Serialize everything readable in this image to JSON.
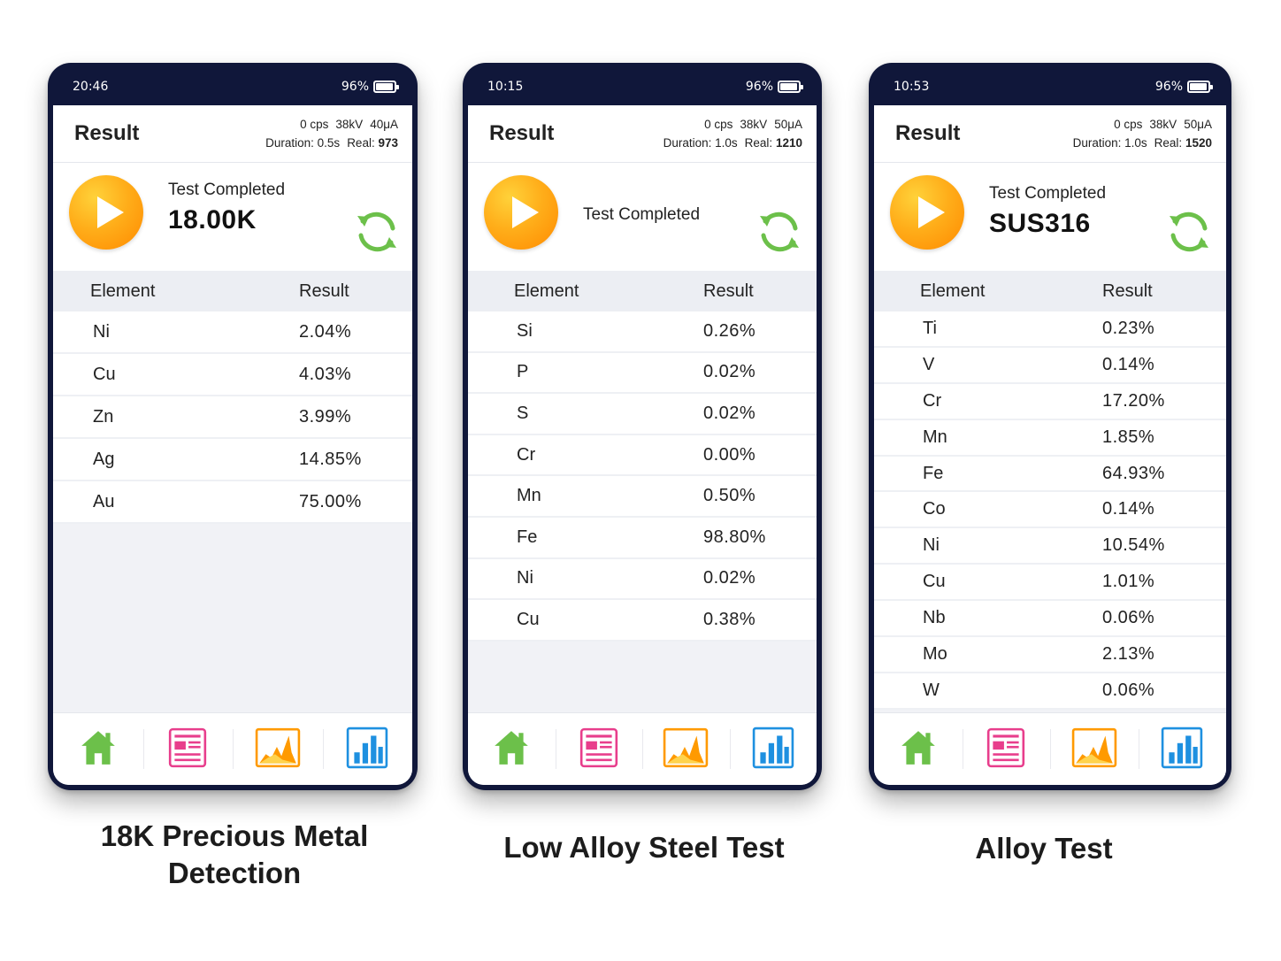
{
  "colors": {
    "frame": "#10173a",
    "play": "#ff9a00",
    "refresh": "#6cc04a",
    "home": "#6cc04a",
    "report": "#e83e8c",
    "spectrum": "#ff9a00",
    "bar_chart": "#1e90e0"
  },
  "icons": [
    "play-icon",
    "refresh-icon",
    "home-icon",
    "report-icon",
    "spectrum-icon",
    "bar-chart-icon",
    "battery-icon"
  ],
  "phones": [
    {
      "time": "20:46",
      "battery": "96%",
      "battery_level": 0.96,
      "title": "Result",
      "cps": "0 cps",
      "kv": "38kV",
      "ua": "40μA",
      "duration_label": "Duration:",
      "duration": "0.5s",
      "real_label": "Real:",
      "real": "973",
      "status": "Test Completed",
      "grade": "18.00K",
      "col_element": "Element",
      "col_result": "Result",
      "rows": [
        {
          "element": "Ni",
          "result": "2.04%"
        },
        {
          "element": "Cu",
          "result": "4.03%"
        },
        {
          "element": "Zn",
          "result": "3.99%"
        },
        {
          "element": "Ag",
          "result": "14.85%"
        },
        {
          "element": "Au",
          "result": "75.00%"
        }
      ],
      "caption_line1": "18K Precious Metal",
      "caption_line2": "Detection"
    },
    {
      "time": "10:15",
      "battery": "96%",
      "battery_level": 0.96,
      "title": "Result",
      "cps": "0 cps",
      "kv": "38kV",
      "ua": "50μA",
      "duration_label": "Duration:",
      "duration": "1.0s",
      "real_label": "Real:",
      "real": "1210",
      "status": "Test Completed",
      "grade": "",
      "col_element": "Element",
      "col_result": "Result",
      "rows": [
        {
          "element": "Si",
          "result": "0.26%"
        },
        {
          "element": "P",
          "result": "0.02%"
        },
        {
          "element": "S",
          "result": "0.02%"
        },
        {
          "element": "Cr",
          "result": "0.00%"
        },
        {
          "element": "Mn",
          "result": "0.50%"
        },
        {
          "element": "Fe",
          "result": "98.80%"
        },
        {
          "element": "Ni",
          "result": "0.02%"
        },
        {
          "element": "Cu",
          "result": "0.38%"
        }
      ],
      "caption_line1": "Low Alloy Steel Test",
      "caption_line2": ""
    },
    {
      "time": "10:53",
      "battery": "96%",
      "battery_level": 0.96,
      "title": "Result",
      "cps": "0 cps",
      "kv": "38kV",
      "ua": "50μA",
      "duration_label": "Duration:",
      "duration": "1.0s",
      "real_label": "Real:",
      "real": "1520",
      "status": "Test Completed",
      "grade": "SUS316",
      "col_element": "Element",
      "col_result": "Result",
      "rows": [
        {
          "element": "Ti",
          "result": "0.23%"
        },
        {
          "element": "V",
          "result": "0.14%"
        },
        {
          "element": "Cr",
          "result": "17.20%"
        },
        {
          "element": "Mn",
          "result": "1.85%"
        },
        {
          "element": "Fe",
          "result": "64.93%"
        },
        {
          "element": "Co",
          "result": "0.14%"
        },
        {
          "element": "Ni",
          "result": "10.54%"
        },
        {
          "element": "Cu",
          "result": "1.01%"
        },
        {
          "element": "Nb",
          "result": "0.06%"
        },
        {
          "element": "Mo",
          "result": "2.13%"
        },
        {
          "element": "W",
          "result": "0.06%"
        }
      ],
      "caption_line1": "Alloy Test",
      "caption_line2": ""
    }
  ]
}
